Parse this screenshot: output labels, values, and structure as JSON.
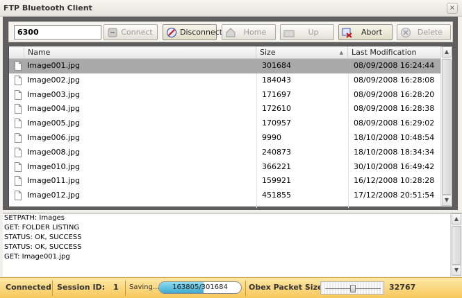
{
  "window": {
    "title": "FTP Bluetooth Client",
    "close_glyph": "×"
  },
  "toolbar": {
    "port_value": "6300",
    "buttons": {
      "connect": {
        "label": "Connect",
        "icon": "connect-icon",
        "enabled": false
      },
      "disconnect": {
        "label": "Disconnect",
        "icon": "disconnect-icon",
        "enabled": true
      },
      "home": {
        "label": "Home",
        "icon": "home-icon",
        "enabled": false
      },
      "up": {
        "label": "Up",
        "icon": "up-folder-icon",
        "enabled": false
      },
      "abort": {
        "label": "Abort",
        "icon": "abort-icon",
        "enabled": true
      },
      "delete": {
        "label": "Delete",
        "icon": "delete-icon",
        "enabled": false
      }
    }
  },
  "file_list": {
    "columns": [
      "Name",
      "Size",
      "Last Modification"
    ],
    "rows": [
      {
        "name": "Image001.jpg",
        "size": "301684",
        "modified": "08/09/2008 16:24:44",
        "selected": true
      },
      {
        "name": "Image002.jpg",
        "size": "184043",
        "modified": "08/09/2008 16:28:08",
        "selected": false
      },
      {
        "name": "Image003.jpg",
        "size": "171697",
        "modified": "08/09/2008 16:28:20",
        "selected": false
      },
      {
        "name": "Image004.jpg",
        "size": "172610",
        "modified": "08/09/2008 16:28:38",
        "selected": false
      },
      {
        "name": "Image005.jpg",
        "size": "170957",
        "modified": "08/09/2008 16:29:02",
        "selected": false
      },
      {
        "name": "Image006.jpg",
        "size": "9990",
        "modified": "18/10/2008 10:48:54",
        "selected": false
      },
      {
        "name": "Image008.jpg",
        "size": "240873",
        "modified": "18/10/2008 18:34:34",
        "selected": false
      },
      {
        "name": "Image010.jpg",
        "size": "366221",
        "modified": "30/10/2008 16:49:42",
        "selected": false
      },
      {
        "name": "Image011.jpg",
        "size": "159921",
        "modified": "16/12/2008 10:28:28",
        "selected": false
      },
      {
        "name": "Image012.jpg",
        "size": "451855",
        "modified": "17/12/2008 20:51:54",
        "selected": false
      }
    ],
    "sort_column": "Size",
    "sort_glyph": "▲"
  },
  "log": {
    "lines": [
      "SETPATH: Images",
      "GET: FOLDER LISTING",
      "STATUS: OK, SUCCESS",
      "STATUS: OK, SUCCESS",
      "GET: Image001.jpg"
    ]
  },
  "status": {
    "connection": "Connected",
    "session_label": "Session ID:",
    "session_id": "1",
    "saving_label": "Saving...",
    "progress_text": "163805/301684",
    "progress_fraction": 0.543,
    "packet_label": "Obex Packet Size:",
    "packet_size": "32767",
    "packet_slider_fraction": 0.5
  },
  "colors": {
    "selected_row": "#a9a9a9",
    "status_bar": "#f7c85a",
    "progress": "#3fa9d0"
  }
}
